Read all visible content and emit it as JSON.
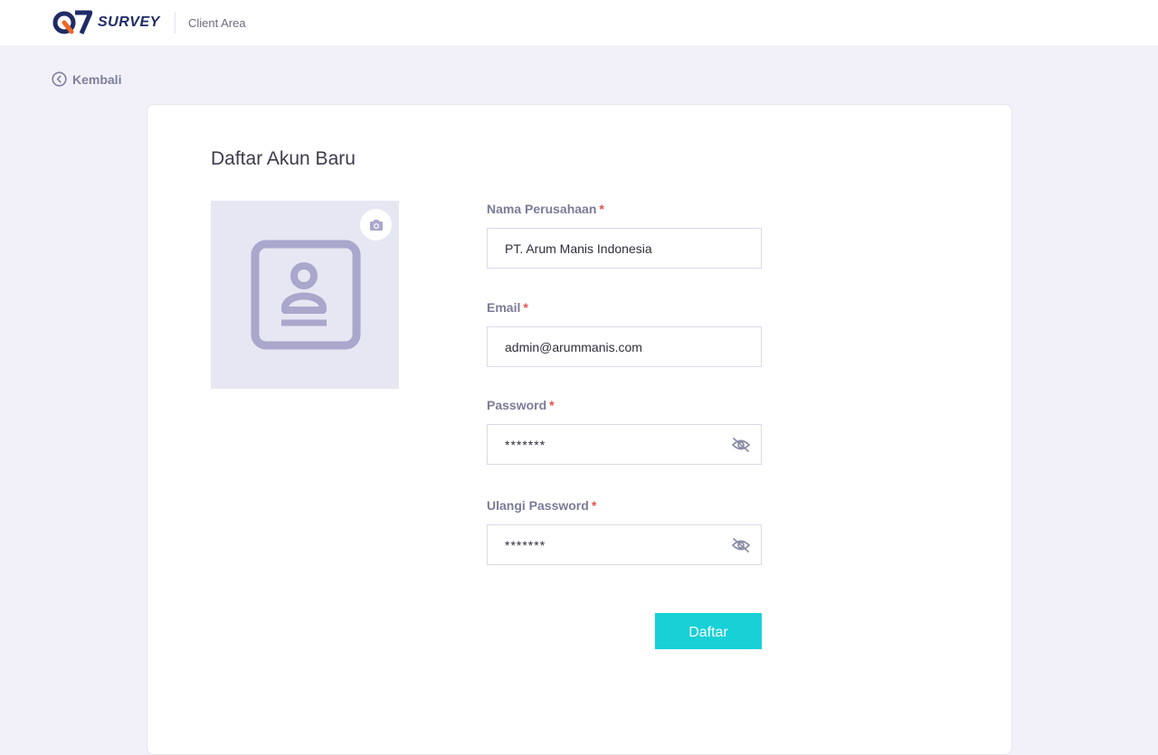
{
  "header": {
    "brand_word": "SURVEY",
    "client_area": "Client Area"
  },
  "nav": {
    "back_label": "Kembali"
  },
  "form": {
    "title": "Daftar Akun Baru",
    "required_mark": "*",
    "company": {
      "label": "Nama Perusahaan",
      "value": "PT. Arum Manis Indonesia"
    },
    "email": {
      "label": "Email",
      "value": "admin@arummanis.com"
    },
    "password": {
      "label": "Password",
      "value": "*******"
    },
    "confirm_password": {
      "label": "Ulangi Password",
      "value": "*******"
    },
    "submit_label": "Daftar"
  },
  "icons": {
    "back": "chevron-left-circle-icon",
    "camera": "camera-icon",
    "placeholder": "contact-card-icon",
    "eye": "eye-off-icon"
  },
  "colors": {
    "accent": "#17d1d6",
    "required": "#e2524a",
    "brand_navy": "#1f2a66",
    "brand_orange": "#f26522",
    "background": "#f2f1fa",
    "placeholder_fill": "#e7e6f3",
    "placeholder_stroke": "#a9a7cb"
  }
}
